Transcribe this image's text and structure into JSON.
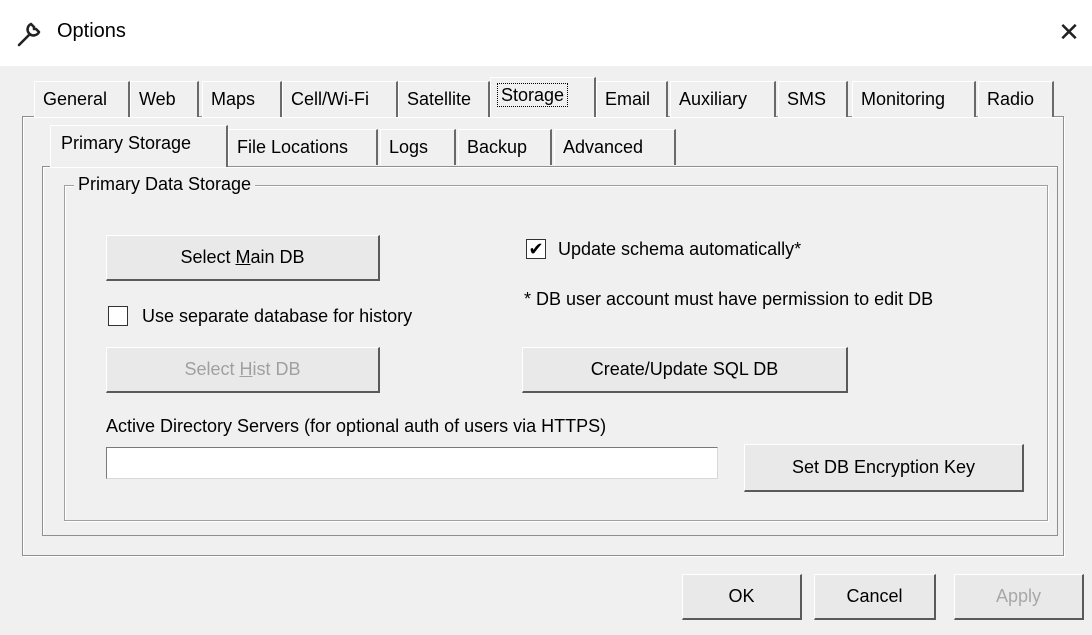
{
  "window": {
    "title": "Options",
    "close_glyph": "✕",
    "icon": "wrench-icon"
  },
  "top_tabs": [
    {
      "label": "General"
    },
    {
      "label": "Web"
    },
    {
      "label": "Maps"
    },
    {
      "label": "Cell/Wi-Fi"
    },
    {
      "label": "Satellite"
    },
    {
      "label": "Storage",
      "selected": true
    },
    {
      "label": "Email"
    },
    {
      "label": "Auxiliary"
    },
    {
      "label": "SMS"
    },
    {
      "label": "Monitoring"
    },
    {
      "label": "Radio"
    }
  ],
  "sub_tabs": [
    {
      "label": "Primary Storage",
      "selected": true
    },
    {
      "label": "File Locations"
    },
    {
      "label": "Logs"
    },
    {
      "label": "Backup"
    },
    {
      "label": "Advanced"
    }
  ],
  "group": {
    "title": "Primary Data Storage",
    "select_main_db": {
      "prefix": "Select ",
      "mnemonic": "M",
      "suffix": "ain DB"
    },
    "use_separate_history": {
      "label": "Use separate database for history",
      "checked": false
    },
    "select_hist_db": {
      "prefix": "Select ",
      "mnemonic": "H",
      "suffix": "ist DB",
      "enabled": false
    },
    "update_schema": {
      "label": "Update schema automatically*",
      "checked": true
    },
    "note": "* DB user account must have permission to edit DB",
    "create_update_sql": "Create/Update SQL DB",
    "ad_servers_label": "Active Directory Servers (for optional auth of users via HTTPS)",
    "ad_servers_value": "",
    "set_encryption_key": "Set DB Encryption Key"
  },
  "footer": {
    "ok": "OK",
    "cancel": "Cancel",
    "apply": "Apply"
  },
  "colors": {
    "window_bg": "#f0f0f0",
    "disabled_text": "#a0a0a0"
  }
}
